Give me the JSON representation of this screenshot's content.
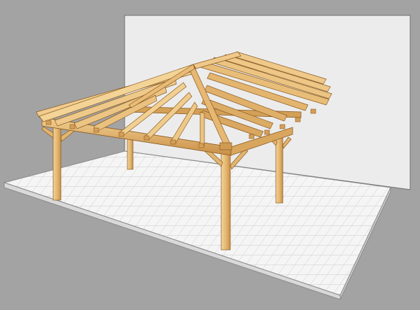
{
  "scene": {
    "description_visible_text": "",
    "colors": {
      "background": "#a3a3a3",
      "wall": "#ececec",
      "wall_edge": "#7a7a7a",
      "floor": "#f4f4f4",
      "floor_grid": "#c9c9c9",
      "floor_edge_front": "#d7d7d7",
      "wood_light": "#efc98a",
      "wood_mid": "#e0b16a",
      "wood_dark": "#c48a43",
      "wood_outline": "#8a5a20"
    }
  }
}
